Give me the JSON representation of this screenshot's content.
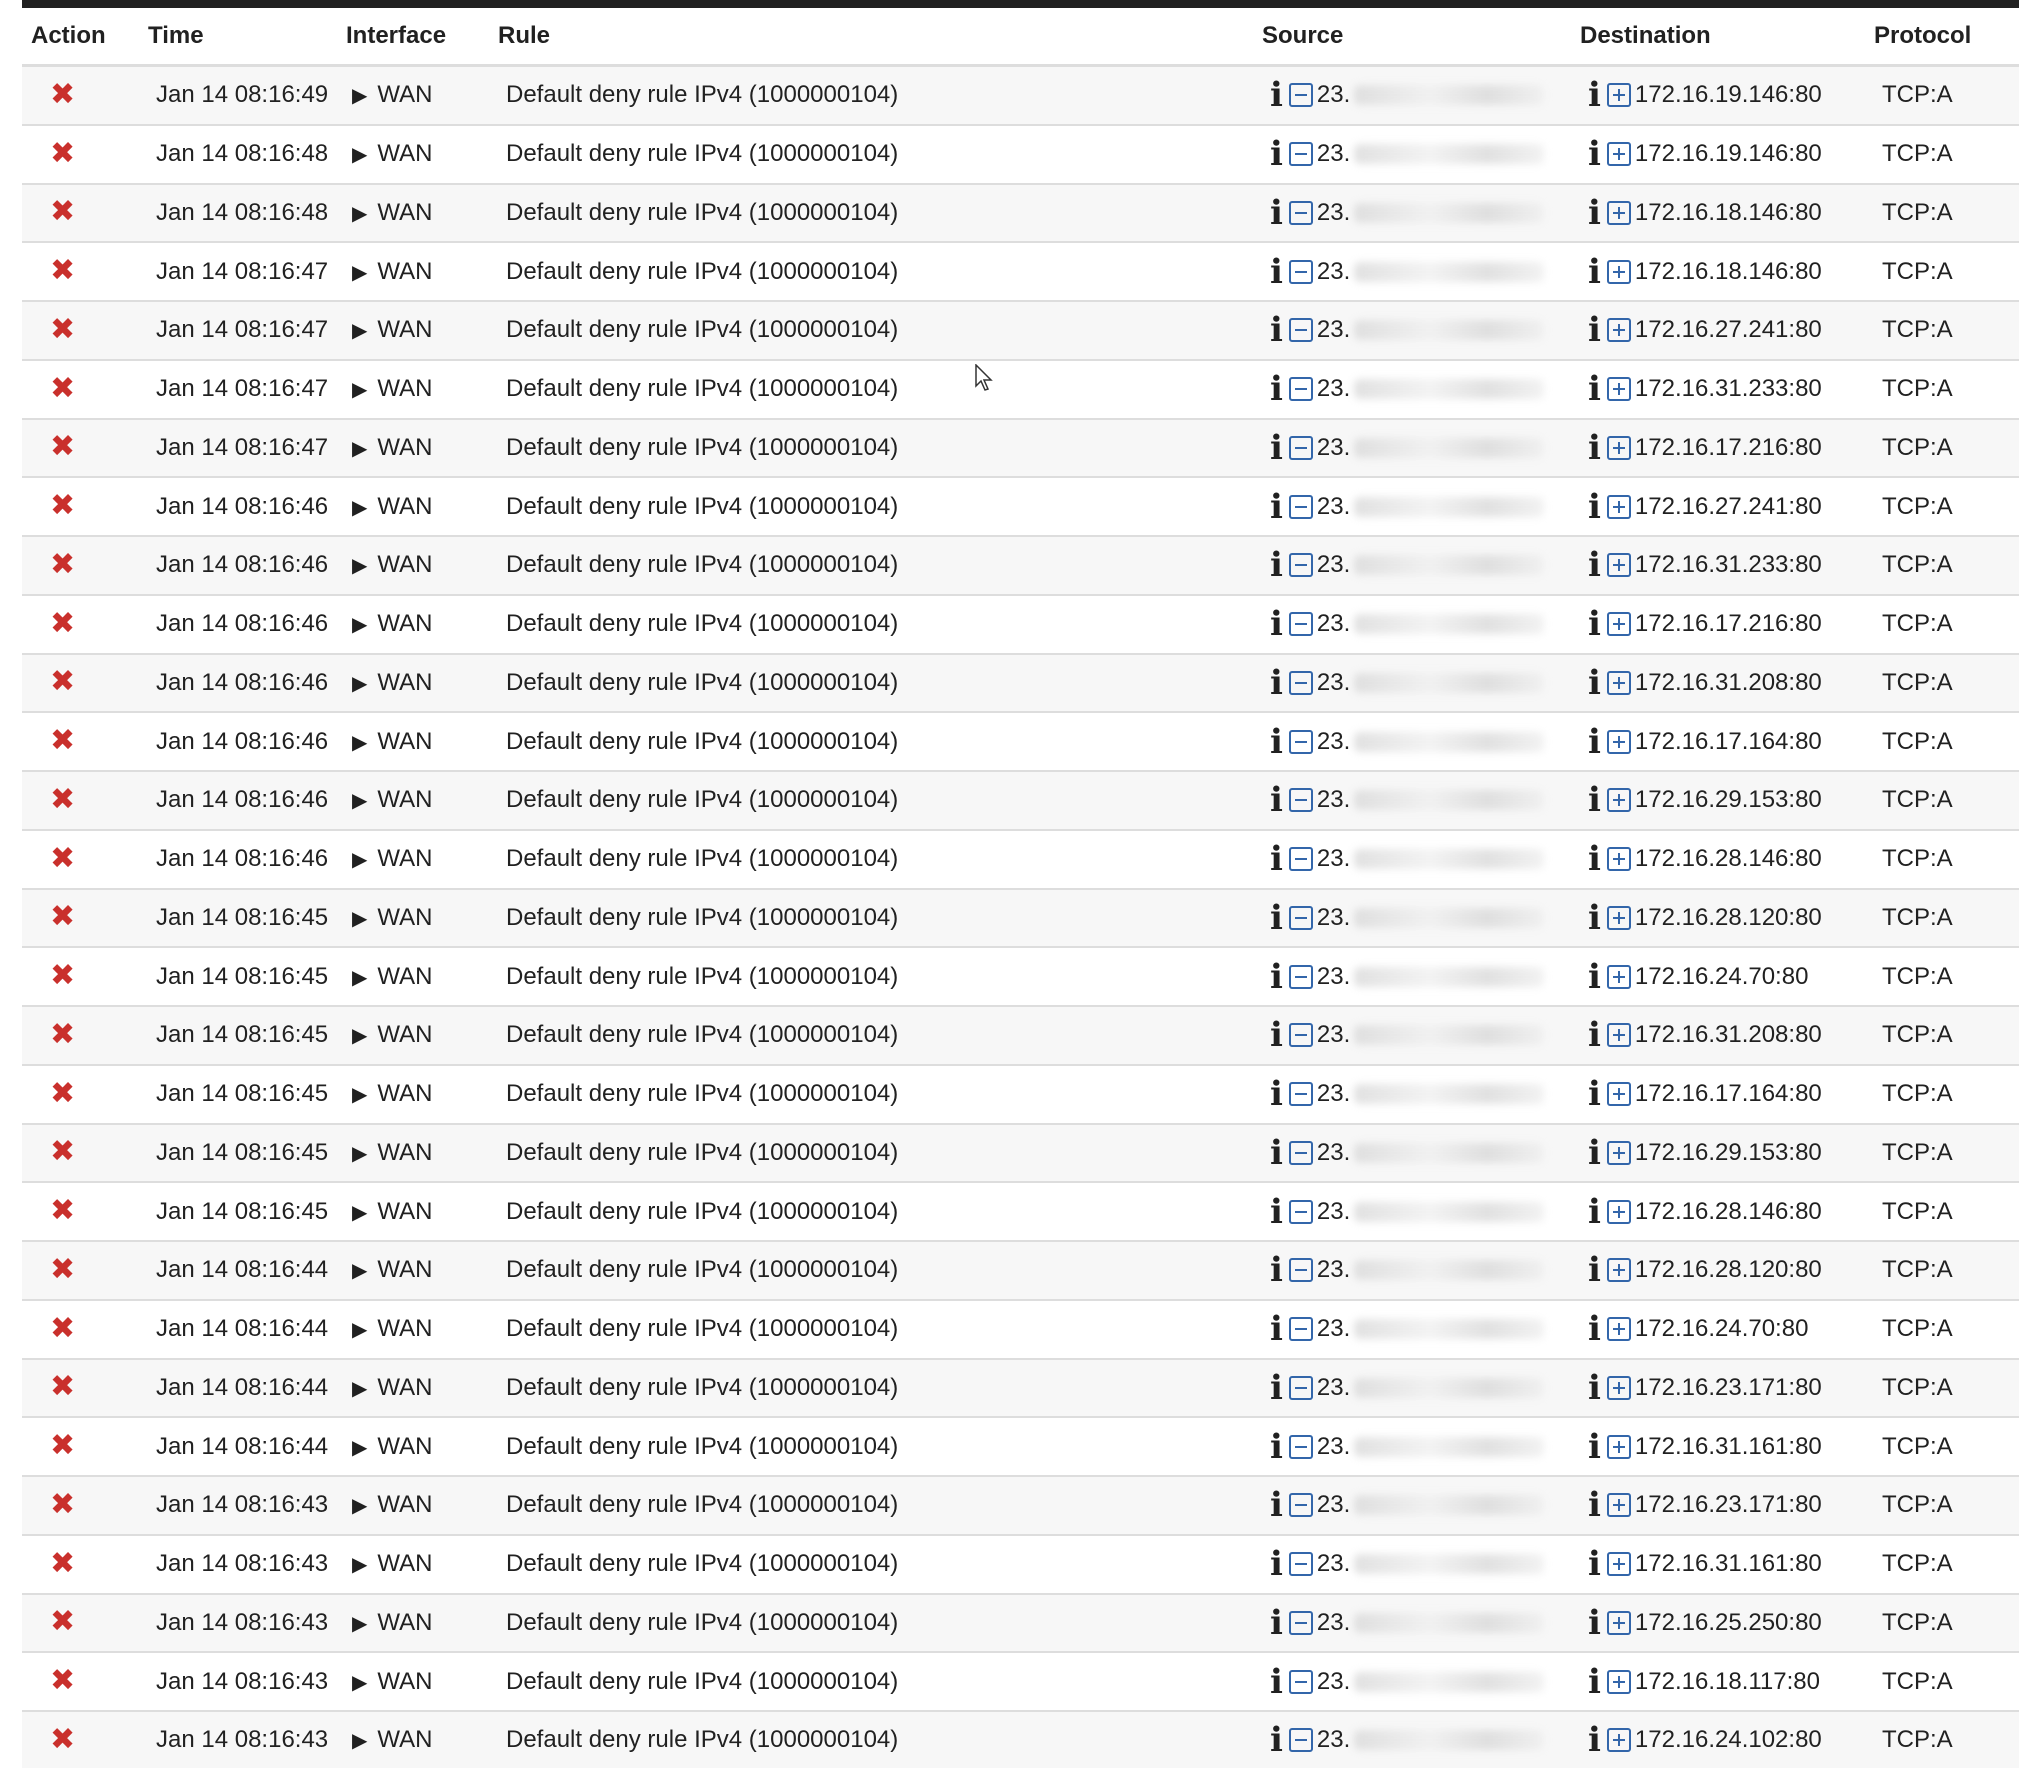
{
  "columns": [
    "Action",
    "Time",
    "Interface",
    "Rule",
    "Source",
    "Destination",
    "Protocol"
  ],
  "rows": [
    {
      "time": "Jan 14 08:16:49",
      "interface": "WAN",
      "rule": "Default deny rule IPv4 (1000000104)",
      "source": "23.",
      "destination": "172.16.19.146:80",
      "protocol": "TCP:A"
    },
    {
      "time": "Jan 14 08:16:48",
      "interface": "WAN",
      "rule": "Default deny rule IPv4 (1000000104)",
      "source": "23.",
      "destination": "172.16.19.146:80",
      "protocol": "TCP:A"
    },
    {
      "time": "Jan 14 08:16:48",
      "interface": "WAN",
      "rule": "Default deny rule IPv4 (1000000104)",
      "source": "23.",
      "destination": "172.16.18.146:80",
      "protocol": "TCP:A"
    },
    {
      "time": "Jan 14 08:16:47",
      "interface": "WAN",
      "rule": "Default deny rule IPv4 (1000000104)",
      "source": "23.",
      "destination": "172.16.18.146:80",
      "protocol": "TCP:A"
    },
    {
      "time": "Jan 14 08:16:47",
      "interface": "WAN",
      "rule": "Default deny rule IPv4 (1000000104)",
      "source": "23.",
      "destination": "172.16.27.241:80",
      "protocol": "TCP:A"
    },
    {
      "time": "Jan 14 08:16:47",
      "interface": "WAN",
      "rule": "Default deny rule IPv4 (1000000104)",
      "source": "23.",
      "destination": "172.16.31.233:80",
      "protocol": "TCP:A"
    },
    {
      "time": "Jan 14 08:16:47",
      "interface": "WAN",
      "rule": "Default deny rule IPv4 (1000000104)",
      "source": "23.",
      "destination": "172.16.17.216:80",
      "protocol": "TCP:A"
    },
    {
      "time": "Jan 14 08:16:46",
      "interface": "WAN",
      "rule": "Default deny rule IPv4 (1000000104)",
      "source": "23.",
      "destination": "172.16.27.241:80",
      "protocol": "TCP:A"
    },
    {
      "time": "Jan 14 08:16:46",
      "interface": "WAN",
      "rule": "Default deny rule IPv4 (1000000104)",
      "source": "23.",
      "destination": "172.16.31.233:80",
      "protocol": "TCP:A"
    },
    {
      "time": "Jan 14 08:16:46",
      "interface": "WAN",
      "rule": "Default deny rule IPv4 (1000000104)",
      "source": "23.",
      "destination": "172.16.17.216:80",
      "protocol": "TCP:A"
    },
    {
      "time": "Jan 14 08:16:46",
      "interface": "WAN",
      "rule": "Default deny rule IPv4 (1000000104)",
      "source": "23.",
      "destination": "172.16.31.208:80",
      "protocol": "TCP:A"
    },
    {
      "time": "Jan 14 08:16:46",
      "interface": "WAN",
      "rule": "Default deny rule IPv4 (1000000104)",
      "source": "23.",
      "destination": "172.16.17.164:80",
      "protocol": "TCP:A"
    },
    {
      "time": "Jan 14 08:16:46",
      "interface": "WAN",
      "rule": "Default deny rule IPv4 (1000000104)",
      "source": "23.",
      "destination": "172.16.29.153:80",
      "protocol": "TCP:A"
    },
    {
      "time": "Jan 14 08:16:46",
      "interface": "WAN",
      "rule": "Default deny rule IPv4 (1000000104)",
      "source": "23.",
      "destination": "172.16.28.146:80",
      "protocol": "TCP:A"
    },
    {
      "time": "Jan 14 08:16:45",
      "interface": "WAN",
      "rule": "Default deny rule IPv4 (1000000104)",
      "source": "23.",
      "destination": "172.16.28.120:80",
      "protocol": "TCP:A"
    },
    {
      "time": "Jan 14 08:16:45",
      "interface": "WAN",
      "rule": "Default deny rule IPv4 (1000000104)",
      "source": "23.",
      "destination": "172.16.24.70:80",
      "protocol": "TCP:A"
    },
    {
      "time": "Jan 14 08:16:45",
      "interface": "WAN",
      "rule": "Default deny rule IPv4 (1000000104)",
      "source": "23.",
      "destination": "172.16.31.208:80",
      "protocol": "TCP:A"
    },
    {
      "time": "Jan 14 08:16:45",
      "interface": "WAN",
      "rule": "Default deny rule IPv4 (1000000104)",
      "source": "23.",
      "destination": "172.16.17.164:80",
      "protocol": "TCP:A"
    },
    {
      "time": "Jan 14 08:16:45",
      "interface": "WAN",
      "rule": "Default deny rule IPv4 (1000000104)",
      "source": "23.",
      "destination": "172.16.29.153:80",
      "protocol": "TCP:A"
    },
    {
      "time": "Jan 14 08:16:45",
      "interface": "WAN",
      "rule": "Default deny rule IPv4 (1000000104)",
      "source": "23.",
      "destination": "172.16.28.146:80",
      "protocol": "TCP:A"
    },
    {
      "time": "Jan 14 08:16:44",
      "interface": "WAN",
      "rule": "Default deny rule IPv4 (1000000104)",
      "source": "23.",
      "destination": "172.16.28.120:80",
      "protocol": "TCP:A"
    },
    {
      "time": "Jan 14 08:16:44",
      "interface": "WAN",
      "rule": "Default deny rule IPv4 (1000000104)",
      "source": "23.",
      "destination": "172.16.24.70:80",
      "protocol": "TCP:A"
    },
    {
      "time": "Jan 14 08:16:44",
      "interface": "WAN",
      "rule": "Default deny rule IPv4 (1000000104)",
      "source": "23.",
      "destination": "172.16.23.171:80",
      "protocol": "TCP:A"
    },
    {
      "time": "Jan 14 08:16:44",
      "interface": "WAN",
      "rule": "Default deny rule IPv4 (1000000104)",
      "source": "23.",
      "destination": "172.16.31.161:80",
      "protocol": "TCP:A"
    },
    {
      "time": "Jan 14 08:16:43",
      "interface": "WAN",
      "rule": "Default deny rule IPv4 (1000000104)",
      "source": "23.",
      "destination": "172.16.23.171:80",
      "protocol": "TCP:A"
    },
    {
      "time": "Jan 14 08:16:43",
      "interface": "WAN",
      "rule": "Default deny rule IPv4 (1000000104)",
      "source": "23.",
      "destination": "172.16.31.161:80",
      "protocol": "TCP:A"
    },
    {
      "time": "Jan 14 08:16:43",
      "interface": "WAN",
      "rule": "Default deny rule IPv4 (1000000104)",
      "source": "23.",
      "destination": "172.16.25.250:80",
      "protocol": "TCP:A"
    },
    {
      "time": "Jan 14 08:16:43",
      "interface": "WAN",
      "rule": "Default deny rule IPv4 (1000000104)",
      "source": "23.",
      "destination": "172.16.18.117:80",
      "protocol": "TCP:A"
    },
    {
      "time": "Jan 14 08:16:43",
      "interface": "WAN",
      "rule": "Default deny rule IPv4 (1000000104)",
      "source": "23.",
      "destination": "172.16.24.102:80",
      "protocol": "TCP:A"
    }
  ],
  "icons": {
    "action": "block-icon",
    "interface": "play-icon",
    "info": "info-icon",
    "source_toggle": "minus-box-icon",
    "destination_toggle": "plus-box-icon"
  },
  "colors": {
    "block": "#c9302c",
    "toggle": "#3366aa",
    "row_alt": "#f7f7f7"
  }
}
